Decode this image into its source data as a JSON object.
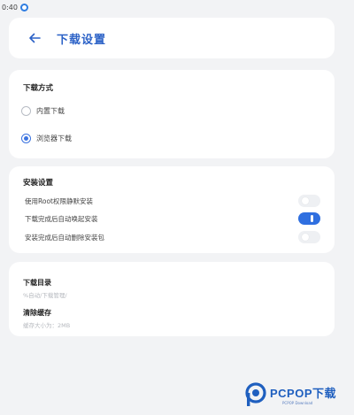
{
  "status_bar": {
    "time": "0:40"
  },
  "header": {
    "title": "下载设置"
  },
  "download_method": {
    "title": "下载方式",
    "options": [
      {
        "label": "内置下载",
        "selected": false
      },
      {
        "label": "浏览器下载",
        "selected": true
      }
    ]
  },
  "install_settings": {
    "title": "安装设置",
    "rows": [
      {
        "label": "使用Root权限静默安装",
        "enabled": false
      },
      {
        "label": "下载完成后自动唤起安装",
        "enabled": true
      },
      {
        "label": "安装完成后自动删除安装包",
        "enabled": false
      }
    ]
  },
  "storage": {
    "download_dir": {
      "title": "下载目录",
      "value": "%自动/下载管理/"
    },
    "clear_cache": {
      "title": "清除缓存",
      "value": "缓存大小为：2MB"
    }
  },
  "watermark": {
    "text": "PCPOP下载",
    "sub": "PCPOP Download"
  },
  "colors": {
    "accent": "#2f6fe0",
    "title_blue": "#2c62c7",
    "background": "#f2f3f5"
  }
}
